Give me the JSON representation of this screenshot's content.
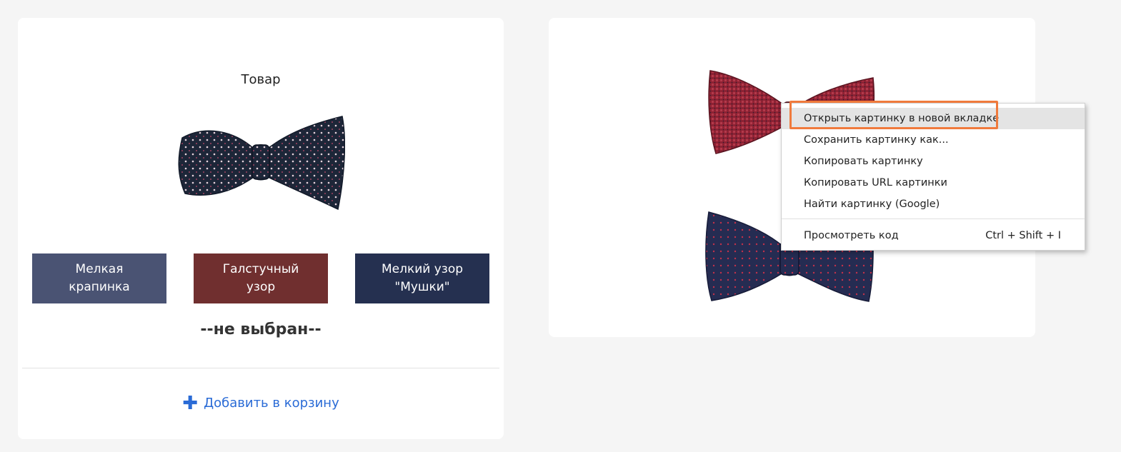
{
  "product": {
    "title": "Товар",
    "variants": [
      {
        "label": "Мелкая\nкрапинка",
        "color": "#4a5373"
      },
      {
        "label": "Галстучный\nузор",
        "color": "#702f2f"
      },
      {
        "label": "Мелкий узор\n\"Мушки\"",
        "color": "#253050"
      }
    ],
    "selected_status": "--не выбран--",
    "add_to_cart": {
      "icon": "plus-icon",
      "label": "Добавить в корзину"
    }
  },
  "context_menu": {
    "items": [
      {
        "label": "Открыть картинку в новой вкладке",
        "highlighted": true
      },
      {
        "label": "Сохранить картинку как..."
      },
      {
        "label": "Копировать картинку"
      },
      {
        "label": "Копировать URL картинки"
      },
      {
        "label": "Найти картинку (Google)"
      },
      {
        "label": "Просмотреть код",
        "shortcut": "Ctrl + Shift + I"
      }
    ]
  },
  "colors": {
    "accent_link": "#2a6bd6",
    "highlight_outline": "#f07a3c"
  }
}
